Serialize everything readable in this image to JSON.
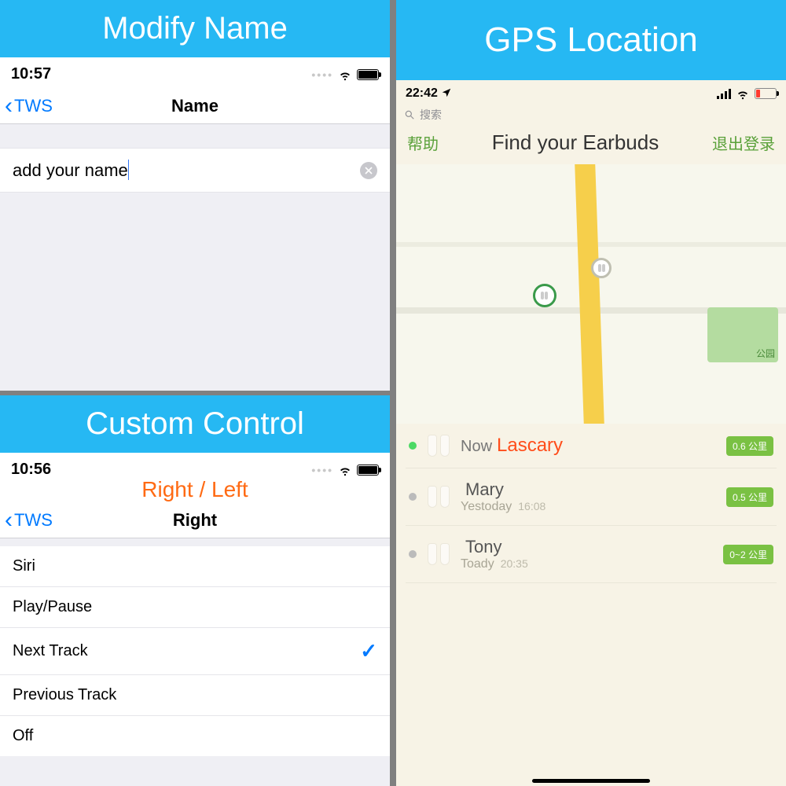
{
  "modify": {
    "banner": "Modify Name",
    "time": "10:57",
    "back": "TWS",
    "title": "Name",
    "input_value": "add your name"
  },
  "custom": {
    "banner": "Custom Control",
    "time": "10:56",
    "overlay": "Right / Left",
    "back": "TWS",
    "title": "Right",
    "options": [
      "Siri",
      "Play/Pause",
      "Next Track",
      "Previous Track",
      "Off"
    ],
    "selected_index": 2
  },
  "gps": {
    "banner": "GPS Location",
    "time": "22:42",
    "search_placeholder": "搜索",
    "help": "帮助",
    "title": "Find your Earbuds",
    "logout": "退出登录",
    "park_label": "公园",
    "devices": [
      {
        "status": "on",
        "when": "Now",
        "name": "Lascary",
        "sub": "",
        "time": "",
        "dist": "0.6 公里",
        "highlight": true
      },
      {
        "status": "off",
        "when": "",
        "name": "Mary",
        "sub": "Yestoday",
        "time": "16:08",
        "dist": "0.5 公里",
        "highlight": false
      },
      {
        "status": "off",
        "when": "",
        "name": "Tony",
        "sub": "Toady",
        "time": "20:35",
        "dist": "0~2 公里",
        "highlight": false
      }
    ]
  }
}
